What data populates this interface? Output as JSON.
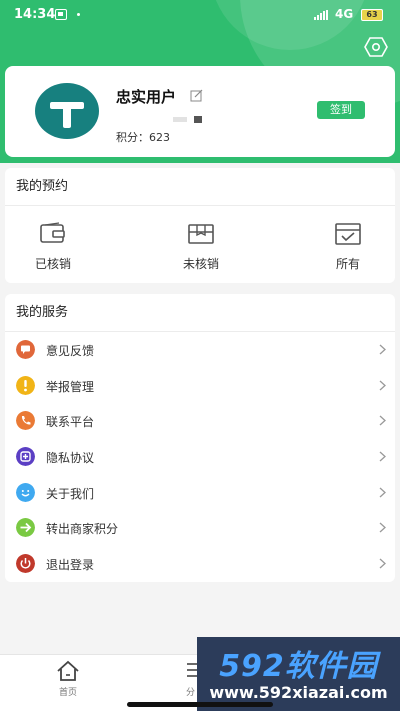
{
  "status_bar": {
    "time": "14:34",
    "network": "4G",
    "battery": "63"
  },
  "profile": {
    "username": "忠实用户",
    "points_label": "积分：",
    "points_value": "623",
    "signin_label": "签到"
  },
  "booking": {
    "title": "我的预约",
    "items": [
      {
        "label": "已核销",
        "icon": "wallet-icon"
      },
      {
        "label": "未核销",
        "icon": "box-icon"
      },
      {
        "label": "所有",
        "icon": "calendar-check-icon"
      }
    ]
  },
  "services": {
    "title": "我的服务",
    "items": [
      {
        "label": "意见反馈",
        "icon": "feedback-icon",
        "color": "#e0673a"
      },
      {
        "label": "举报管理",
        "icon": "report-icon",
        "color": "#f1b417"
      },
      {
        "label": "联系平台",
        "icon": "phone-icon",
        "color": "#ea7a35"
      },
      {
        "label": "隐私协议",
        "icon": "privacy-icon",
        "color": "#5b3fc4"
      },
      {
        "label": "关于我们",
        "icon": "smile-icon",
        "color": "#3fa9f0"
      },
      {
        "label": "转出商家积分",
        "icon": "transfer-icon",
        "color": "#7ac943"
      },
      {
        "label": "退出登录",
        "icon": "power-icon",
        "color": "#c0392b"
      }
    ]
  },
  "tabbar": {
    "home_label": "首页",
    "cat_label": "分"
  },
  "watermark": {
    "brand": "592软件园",
    "url": "www.592xiazai.com"
  },
  "colors": {
    "accent": "#2fbd6f",
    "avatar": "#17807f"
  }
}
